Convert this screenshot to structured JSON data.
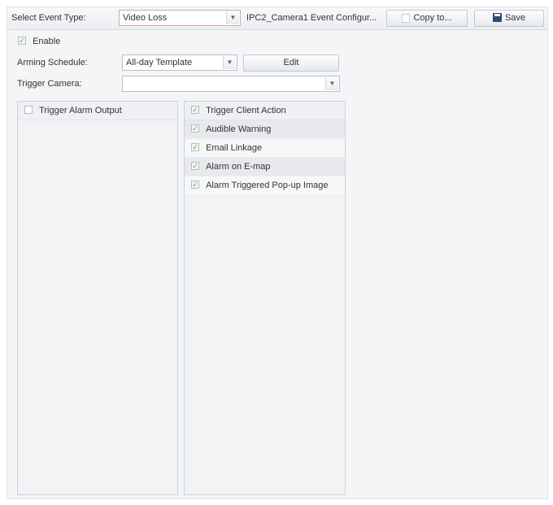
{
  "toolbar": {
    "event_type_label": "Select Event Type:",
    "event_type_value": "Video Loss",
    "config_title": "IPC2_Camera1 Event Configur...",
    "copy_label": "Copy to...",
    "save_label": "Save"
  },
  "form": {
    "enable_label": "Enable",
    "enable_checked": true,
    "arming_label": "Arming Schedule:",
    "arming_value": "All-day Template",
    "edit_label": "Edit",
    "trigger_camera_label": "Trigger Camera:",
    "trigger_camera_value": ""
  },
  "alarm_output": {
    "header": "Trigger Alarm Output",
    "checked": false
  },
  "client_action": {
    "header": "Trigger Client Action",
    "items": [
      {
        "label": "Audible Warning",
        "checked": true
      },
      {
        "label": "Email Linkage",
        "checked": true
      },
      {
        "label": "Alarm on E-map",
        "checked": true
      },
      {
        "label": "Alarm Triggered Pop-up Image",
        "checked": true
      }
    ]
  },
  "icons": {
    "check": "✓",
    "dropdown": "▼"
  }
}
